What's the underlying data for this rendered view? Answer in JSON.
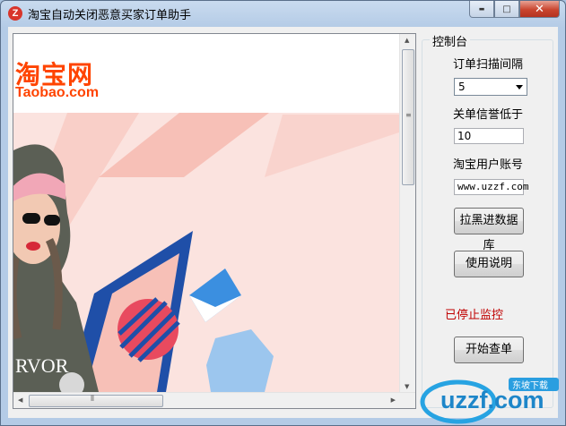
{
  "window": {
    "title": "淘宝自动关闭恶意买家订单助手",
    "app_icon_letter": "Z",
    "controls": {
      "minimize": "▬",
      "maximize": "□",
      "close": "✕"
    }
  },
  "browser": {
    "logo_cn": "淘宝网",
    "logo_en": "Taobao.com"
  },
  "panel": {
    "group_title": "控制台",
    "scan_interval_label": "订单扫描间隔",
    "scan_interval_value": "5",
    "credit_label": "关单信誉低于",
    "credit_value": "10",
    "account_label": "淘宝用户账号",
    "account_value": "www.uzzf.com",
    "blacklist_button": "拉黑进数据库",
    "help_button": "使用说明",
    "status_text": "已停止监控",
    "start_button": "开始查单"
  },
  "watermark": {
    "brand": "uzzf.com",
    "tag": "东坡下载"
  },
  "colors": {
    "accent_red": "#c00000",
    "logo_orange": "#ff4400",
    "banner_pink": "#fbe3df"
  }
}
